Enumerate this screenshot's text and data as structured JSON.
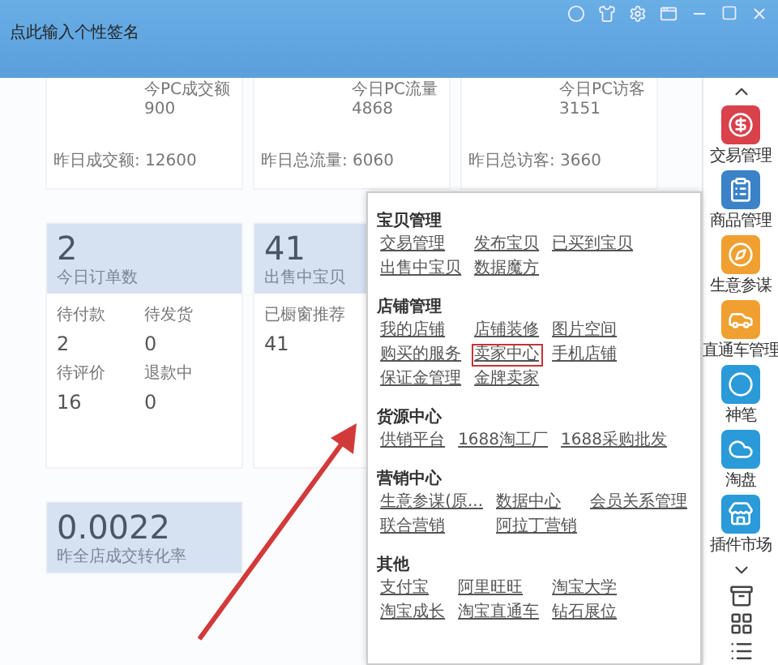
{
  "header": {
    "signature": "点此输入个性签名"
  },
  "top_cards": [
    {
      "label": "今PC成交额",
      "value": "900",
      "yesterday": "昨日成交额: 12600"
    },
    {
      "label": "今日PC流量",
      "value": "4868",
      "yesterday": "昨日总流量: 6060"
    },
    {
      "label": "今日PC访客",
      "value": "3151",
      "yesterday": "昨日总访客: 3660"
    }
  ],
  "order_card": {
    "value": "2",
    "label": "今日订单数",
    "stats": [
      {
        "label": "待付款",
        "value": "2"
      },
      {
        "label": "待发货",
        "value": "0"
      },
      {
        "label": "待评价",
        "value": "16"
      },
      {
        "label": "退款中",
        "value": "0"
      }
    ]
  },
  "items_card": {
    "value": "41",
    "label": "出售中宝贝",
    "stats": [
      {
        "label": "已橱窗推荐",
        "value": "41"
      }
    ]
  },
  "conversion_card": {
    "value": "0.0022",
    "label": "昨全店成交转化率"
  },
  "menu": {
    "sections": [
      {
        "title": "宝贝管理",
        "items": [
          {
            "label": "交易管理",
            "highlighted": false
          },
          {
            "label": "发布宝贝",
            "highlighted": false
          },
          {
            "label": "已买到宝贝",
            "highlighted": false
          },
          {
            "label": "出售中宝贝",
            "highlighted": false
          },
          {
            "label": "数据魔方",
            "highlighted": false
          }
        ]
      },
      {
        "title": "店铺管理",
        "items": [
          {
            "label": "我的店铺",
            "highlighted": false
          },
          {
            "label": "店铺装修",
            "highlighted": false
          },
          {
            "label": "图片空间",
            "highlighted": false
          },
          {
            "label": "购买的服务",
            "highlighted": false
          },
          {
            "label": "卖家中心",
            "highlighted": true
          },
          {
            "label": "手机店铺",
            "highlighted": false
          },
          {
            "label": "保证金管理",
            "highlighted": false
          },
          {
            "label": "金牌卖家",
            "highlighted": false
          }
        ]
      },
      {
        "title": "货源中心",
        "items": [
          {
            "label": "供销平台",
            "highlighted": false
          },
          {
            "label": "1688淘工厂",
            "highlighted": false
          },
          {
            "label": "1688采购批发",
            "highlighted": false
          }
        ]
      },
      {
        "title": "营销中心",
        "items": [
          {
            "label": "生意参谋(原...",
            "highlighted": false
          },
          {
            "label": "数据中心",
            "highlighted": false
          },
          {
            "label": "会员关系管理",
            "highlighted": false
          },
          {
            "label": "联合营销",
            "highlighted": false
          },
          {
            "label": "阿拉丁营销",
            "highlighted": false
          }
        ]
      },
      {
        "title": "其他",
        "items": [
          {
            "label": "支付宝",
            "highlighted": false
          },
          {
            "label": "阿里旺旺",
            "highlighted": false
          },
          {
            "label": "淘宝大学",
            "highlighted": false
          },
          {
            "label": "淘宝成长",
            "highlighted": false
          },
          {
            "label": "淘宝直通车",
            "highlighted": false
          },
          {
            "label": "钻石展位",
            "highlighted": false
          }
        ]
      }
    ]
  },
  "sidebar": {
    "items": [
      {
        "label": "交易管理",
        "kind": "coin",
        "color": "#d9414b"
      },
      {
        "label": "商品管理",
        "kind": "clipboard",
        "color": "#3b82c8"
      },
      {
        "label": "生意参谋",
        "kind": "compass",
        "color": "#f0a030"
      },
      {
        "label": "直通车管理",
        "kind": "car",
        "color": "#f0a030"
      },
      {
        "label": "神笔",
        "kind": "swirl",
        "color": "#2a9ad8"
      },
      {
        "label": "淘盘",
        "kind": "cloud",
        "color": "#2a9ad8"
      },
      {
        "label": "插件市场",
        "kind": "store",
        "color": "#2a9ad8"
      }
    ]
  }
}
